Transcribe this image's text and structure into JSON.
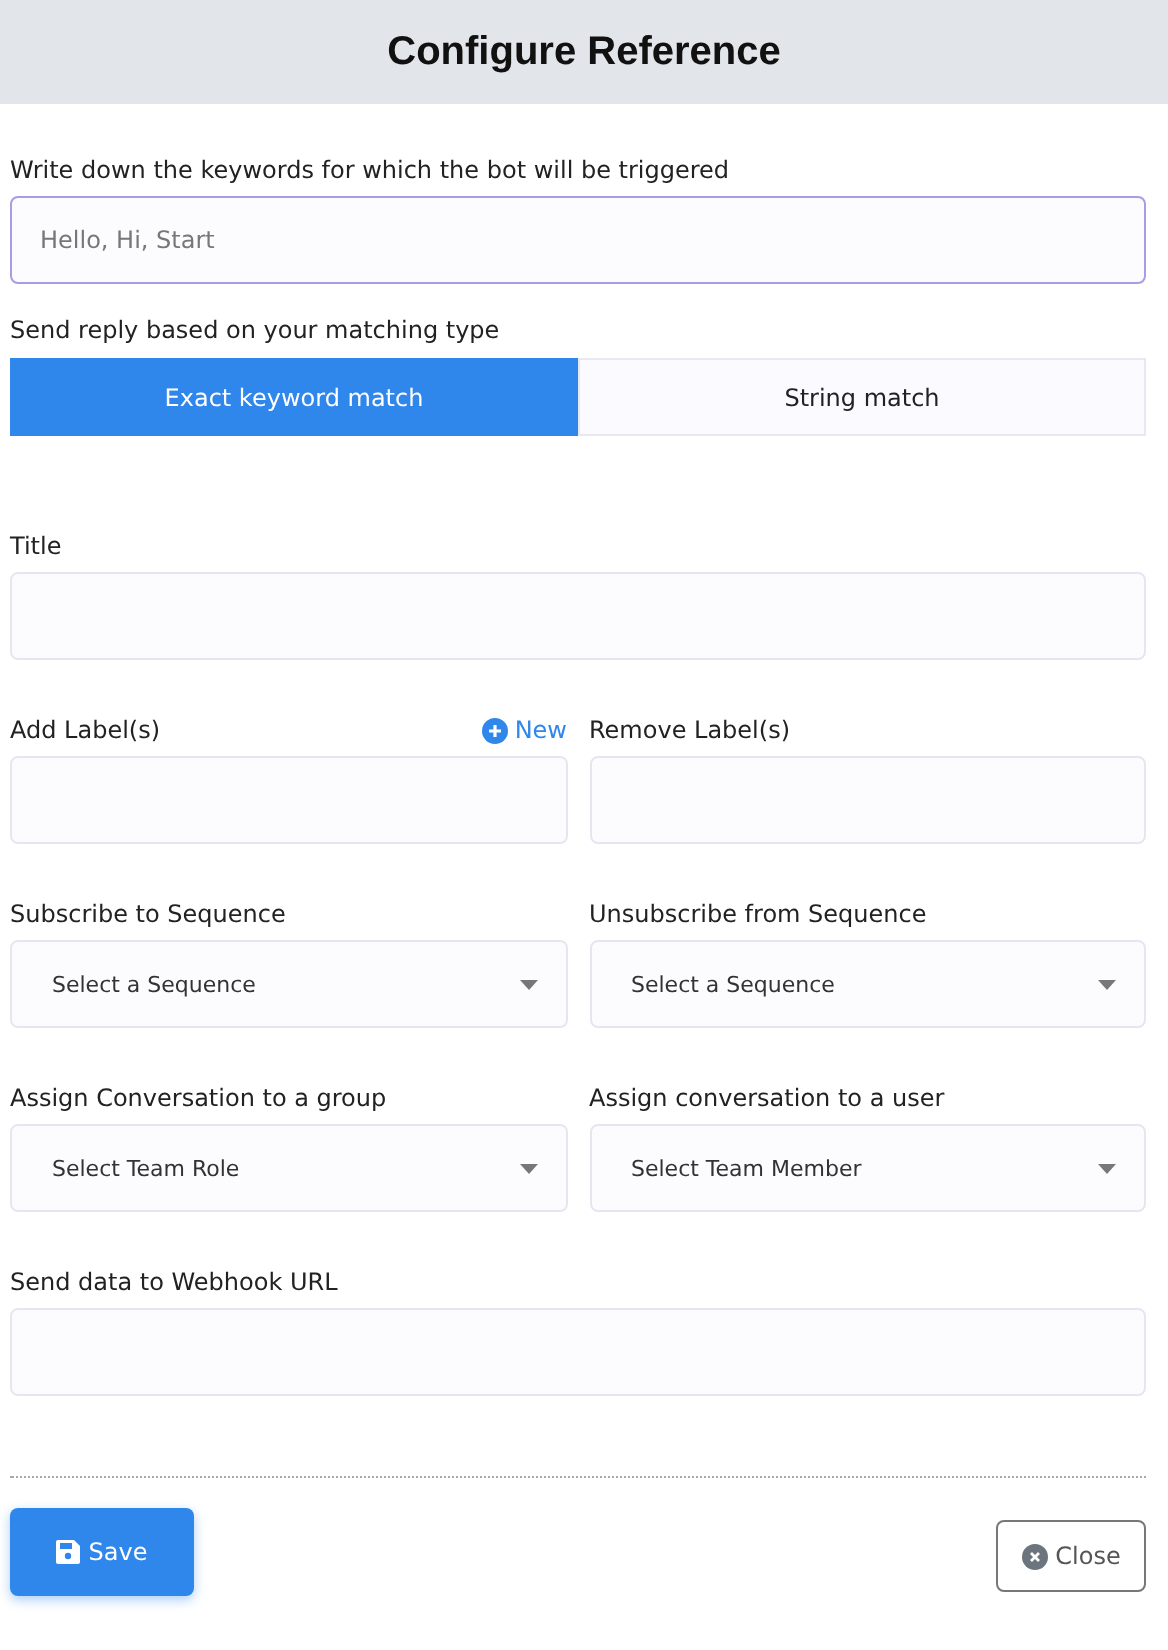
{
  "window": {
    "title": "Configure Reference"
  },
  "keywords": {
    "label": "Write down the keywords for which the bot will be triggered",
    "placeholder": "Hello, Hi, Start"
  },
  "matching": {
    "label": "Send reply based on your matching type",
    "options": [
      {
        "label": "Exact keyword match",
        "selected": true
      },
      {
        "label": "String match",
        "selected": false
      }
    ]
  },
  "rows": [
    [
      {
        "label": "Title",
        "kind": "text"
      }
    ],
    [
      {
        "label": "Add Label(s)",
        "kind": "text",
        "action": "New"
      },
      {
        "label": "Remove Label(s)",
        "kind": "text"
      }
    ],
    [
      {
        "label": "Subscribe to Sequence",
        "kind": "select",
        "placeholder": "Select a Sequence"
      },
      {
        "label": "Unsubscribe from Sequence",
        "kind": "select",
        "placeholder": "Select a Sequence"
      }
    ],
    [
      {
        "label": "Assign Conversation to a group",
        "kind": "select",
        "placeholder": "Select Team Role"
      },
      {
        "label": "Assign conversation to a user",
        "kind": "select",
        "placeholder": "Select Team Member"
      }
    ],
    [
      {
        "label": "Send data to Webhook URL",
        "kind": "text"
      }
    ]
  ],
  "buttons": {
    "save": "Save",
    "close": "Close"
  }
}
